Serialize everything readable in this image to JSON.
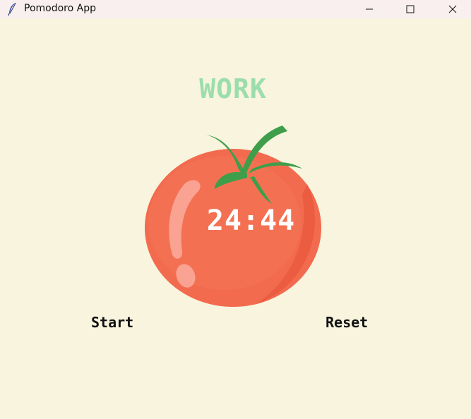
{
  "window": {
    "title": "Pomodoro App",
    "icon": "feather-icon",
    "controls": [
      "minimize-icon",
      "maximize-icon",
      "close-icon"
    ]
  },
  "timer": {
    "mode_label": "WORK",
    "display": "24:44"
  },
  "buttons": {
    "start_label": "Start",
    "reset_label": "Reset"
  },
  "colors": {
    "background": "#f8f4de",
    "mode_label": "#9bdeac",
    "tomato": "#f26b4f",
    "leaf": "#3e9e49",
    "timer_text": "#ffffff"
  }
}
